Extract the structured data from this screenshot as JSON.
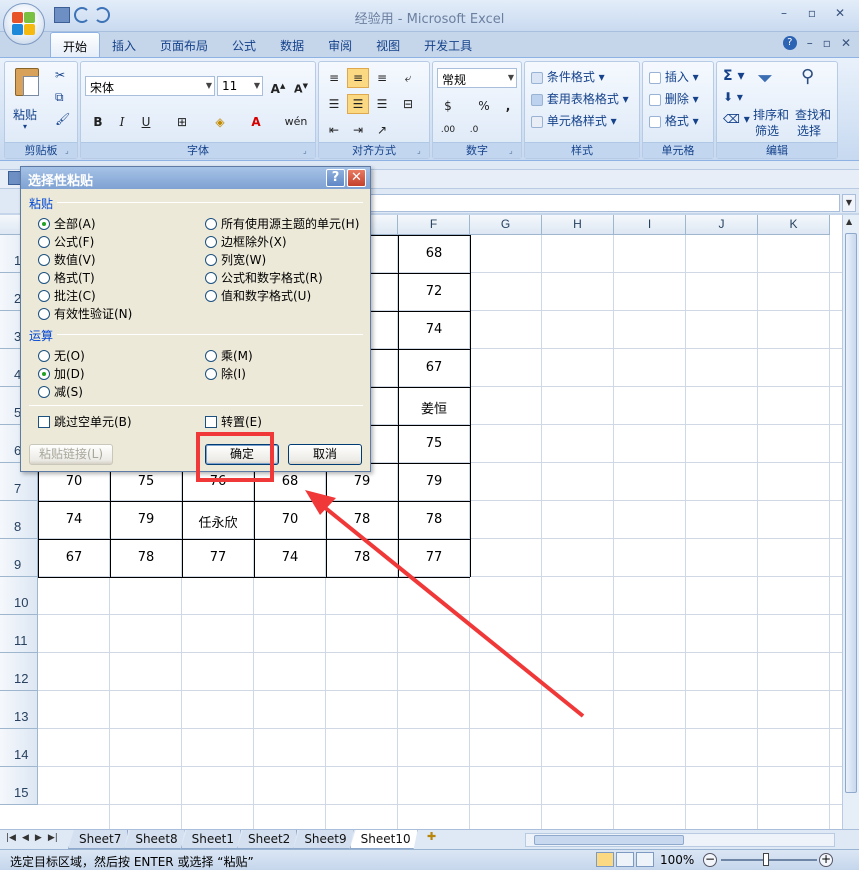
{
  "window": {
    "title": "经验用 - Microsoft Excel"
  },
  "tabs": [
    "开始",
    "插入",
    "页面布局",
    "公式",
    "数据",
    "审阅",
    "视图",
    "开发工具"
  ],
  "ribbon": {
    "clipboard": {
      "paste": "粘贴",
      "label": "剪贴板"
    },
    "font": {
      "name": "宋体",
      "size": "11",
      "label": "字体"
    },
    "align": {
      "label": "对齐方式"
    },
    "number": {
      "format": "常规",
      "label": "数字"
    },
    "styles": {
      "cond": "条件格式",
      "table": "套用表格格式",
      "cell": "单元格样式",
      "label": "样式"
    },
    "cells": {
      "insert": "插入",
      "delete": "删除",
      "format": "格式",
      "label": "单元格"
    },
    "editing": {
      "sort": "排序和",
      "sort2": "筛选",
      "find": "查找和",
      "find2": "选择",
      "label": "编辑"
    }
  },
  "columns": [
    "F",
    "G",
    "H",
    "I",
    "J",
    "K"
  ],
  "rows": [
    "1",
    "2",
    "3",
    "4",
    "5",
    "6",
    "7",
    "8",
    "9",
    "10",
    "11",
    "12",
    "13",
    "14",
    "15"
  ],
  "cellsF": [
    "68",
    "72",
    "74",
    "67",
    "姜恒",
    "75",
    "79",
    "78",
    "77"
  ],
  "cellsRow7": [
    "70",
    "75",
    "76",
    "68",
    "79"
  ],
  "cellsRow8": [
    "74",
    "79",
    "任永欣",
    "70",
    "78"
  ],
  "cellsRow9": [
    "67",
    "78",
    "77",
    "74",
    "78"
  ],
  "dialog": {
    "title": "选择性粘贴",
    "paste_section": "粘贴",
    "paste_options_left": [
      "全部(A)",
      "公式(F)",
      "数值(V)",
      "格式(T)",
      "批注(C)",
      "有效性验证(N)"
    ],
    "paste_options_right": [
      "所有使用源主题的单元(H)",
      "边框除外(X)",
      "列宽(W)",
      "公式和数字格式(R)",
      "值和数字格式(U)"
    ],
    "op_section": "运算",
    "op_left": [
      "无(O)",
      "加(D)",
      "减(S)"
    ],
    "op_right": [
      "乘(M)",
      "除(I)"
    ],
    "skip_blanks": "跳过空单元(B)",
    "transpose": "转置(E)",
    "paste_link": "粘贴链接(L)",
    "ok": "确定",
    "cancel": "取消",
    "selected_paste": "全部(A)",
    "selected_op": "加(D)"
  },
  "sheets": [
    "Sheet7",
    "Sheet8",
    "Sheet1",
    "Sheet2",
    "Sheet9",
    "Sheet10"
  ],
  "active_sheet": "Sheet10",
  "status": {
    "text": "选定目标区域，然后按 ENTER 或选择 “粘贴”",
    "zoom": "100%"
  },
  "colors": {
    "highlight": "#f03838",
    "accent": "#15428b"
  }
}
